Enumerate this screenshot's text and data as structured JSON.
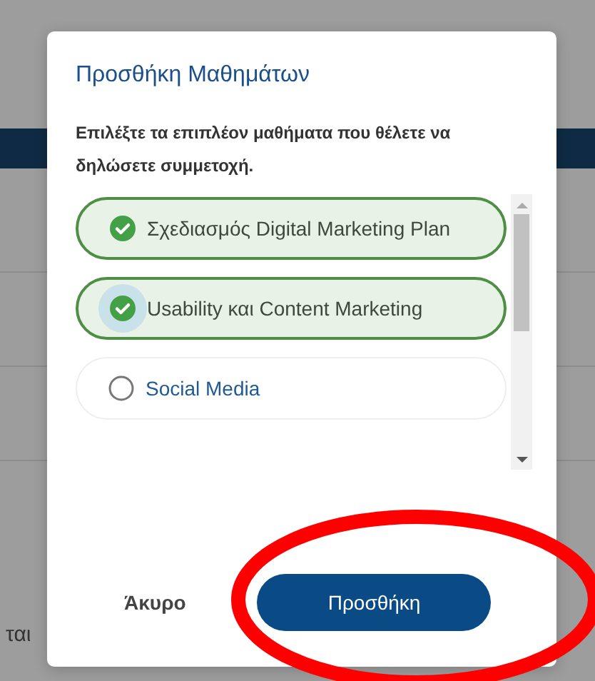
{
  "background_page": {
    "text_lines": [
      "ται"
    ]
  },
  "dialog": {
    "title": "Προσθήκη Μαθημάτων",
    "description": "Επιλέξτε τα επιπλέον μαθήματα που θέλετε να δηλώσετε συμμετοχή.",
    "courses": [
      {
        "label": "Σχεδιασμός Digital Marketing Plan",
        "selected": true,
        "focused": false
      },
      {
        "label": "Usability και Content Marketing",
        "selected": true,
        "focused": true
      },
      {
        "label": "Social Media",
        "selected": false,
        "focused": false
      }
    ],
    "buttons": [
      {
        "kind": "text",
        "label": "Άκυρο"
      },
      {
        "kind": "primary",
        "label": "Προσθήκη"
      }
    ]
  },
  "annotation": {
    "kind": "ellipse",
    "color": "#ff0000"
  }
}
